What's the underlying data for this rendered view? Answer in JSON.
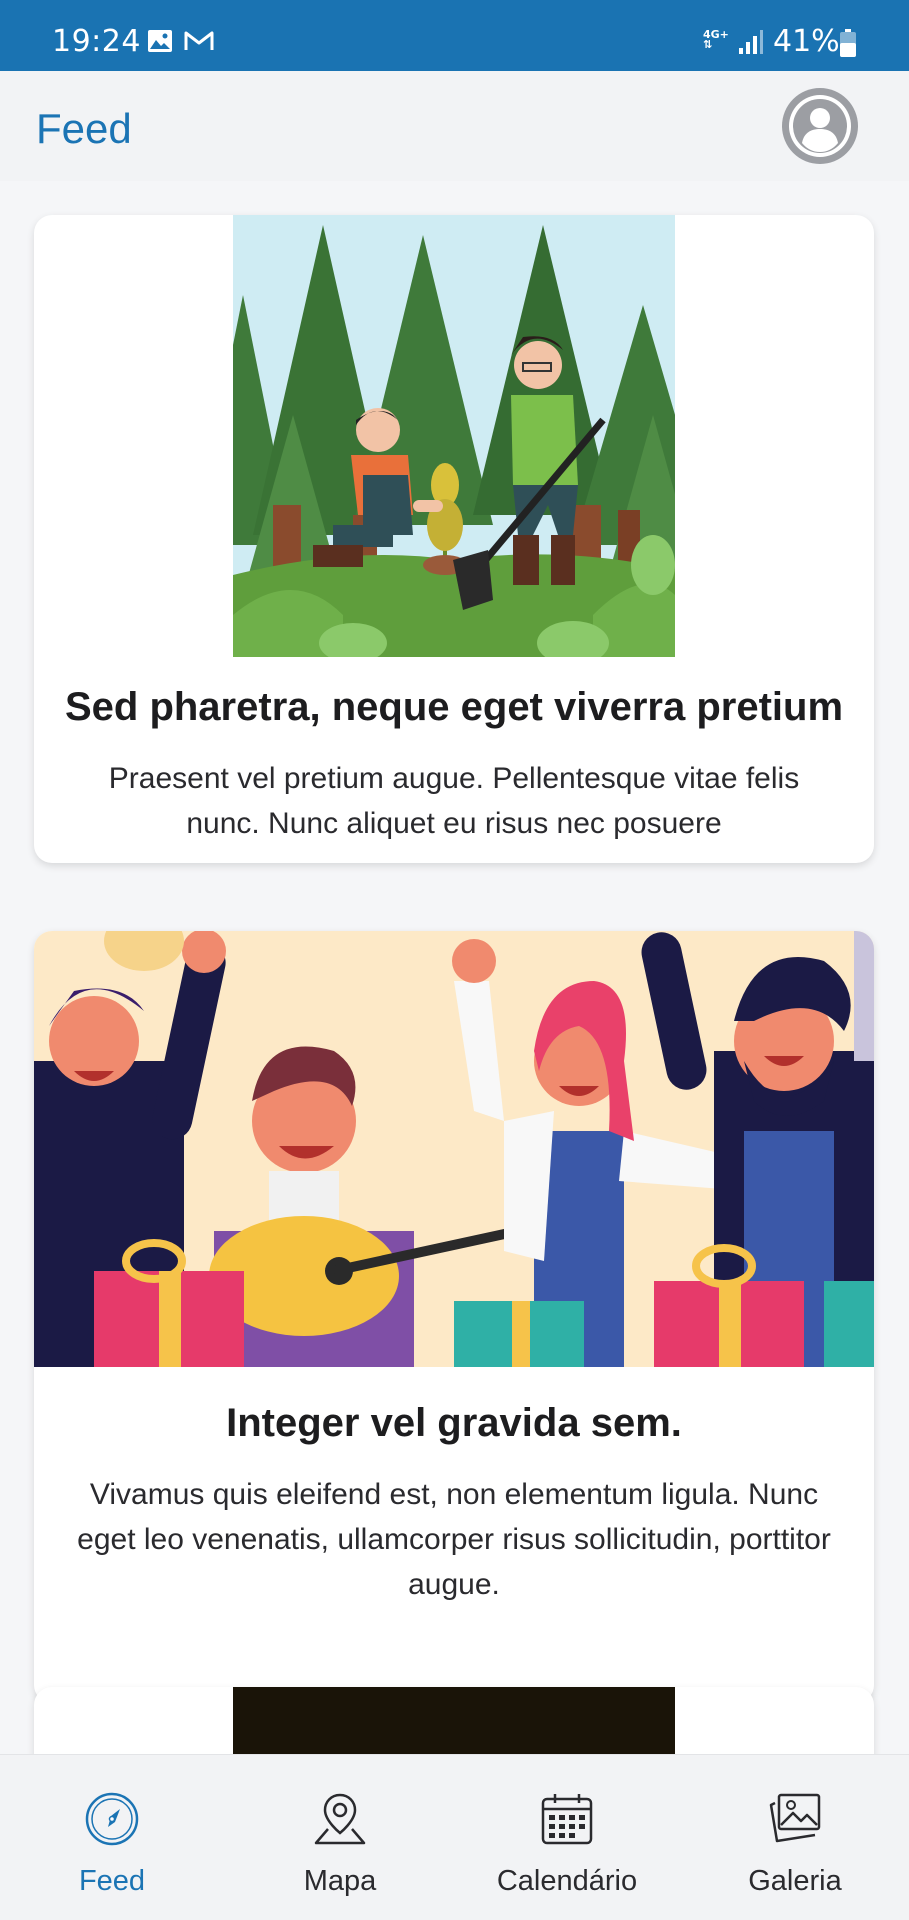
{
  "status_bar": {
    "time": "19:24",
    "network_top": "4G+",
    "network_bottom": "⇅",
    "battery": "41%"
  },
  "header": {
    "title": "Feed",
    "avatar_icon": "user-avatar-icon"
  },
  "feed": {
    "cards": [
      {
        "image": "tree-planting-illustration",
        "title": "Sed pharetra, neque eget viverra pretium",
        "description": "Praesent vel pretium augue. Pellentesque vitae felis nunc. Nunc aliquet eu risus nec posuere"
      },
      {
        "image": "party-celebration-illustration",
        "title": "Integer vel gravida sem.",
        "description": "Vivamus quis eleifend est, non elementum ligula. Nunc eget leo venenatis, ullamcorper risus sollicitudin, porttitor augue."
      },
      {
        "image": "dark-theater-illustration",
        "title": "",
        "description": ""
      }
    ]
  },
  "bottom_nav": {
    "items": [
      {
        "label": "Feed",
        "icon": "compass-icon",
        "active": true
      },
      {
        "label": "Mapa",
        "icon": "map-pin-icon",
        "active": false
      },
      {
        "label": "Calendário",
        "icon": "calendar-icon",
        "active": false
      },
      {
        "label": "Galeria",
        "icon": "gallery-icon",
        "active": false
      }
    ]
  },
  "colors": {
    "accent": "#1b74b4",
    "status_bar": "#1a73b2",
    "background": "#f5f6f8"
  }
}
